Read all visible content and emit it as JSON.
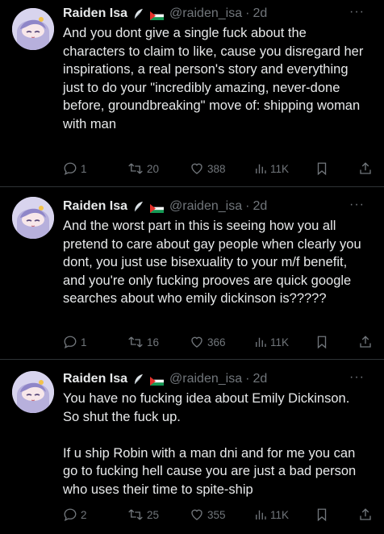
{
  "tweets": [
    {
      "name": "Raiden Isa",
      "handle": "@raiden_isa",
      "dot": "·",
      "time": "2d",
      "text": "And you dont give a single fuck about the characters to claim to like, cause you disregard her inspirations, a real person's story and everything just to do your \"incredibly amazing, never-done before, groundbreaking\" move of: shipping woman with man",
      "replies": "1",
      "reposts": "20",
      "likes": "388",
      "views": "11K"
    },
    {
      "name": "Raiden Isa",
      "handle": "@raiden_isa",
      "dot": "·",
      "time": "2d",
      "text": "And the worst part in this is seeing how you all pretend to care about gay people when clearly you dont, you just use bisexuality to your m/f benefit, and you're only fucking prooves are quick google searches about who emily dickinson is?????",
      "replies": "1",
      "reposts": "16",
      "likes": "366",
      "views": "11K"
    },
    {
      "name": "Raiden Isa",
      "handle": "@raiden_isa",
      "dot": "·",
      "time": "2d",
      "text": "You have no fucking idea about Emily Dickinson. So shut the fuck up.\n\nIf u ship Robin with a man dni and for me you can go to fucking hell cause you are just a bad person who uses their time to spite-ship",
      "replies": "2",
      "reposts": "25",
      "likes": "355",
      "views": "11K"
    }
  ],
  "colors": {
    "text": "#e7e9ea",
    "muted": "#71767b",
    "background": "#000000",
    "divider": "#2f3336"
  },
  "icons": [
    "reply-icon",
    "repost-icon",
    "like-icon",
    "views-icon",
    "bookmark-icon",
    "share-icon",
    "more-icon",
    "feather-badge-icon",
    "flag-icon"
  ]
}
